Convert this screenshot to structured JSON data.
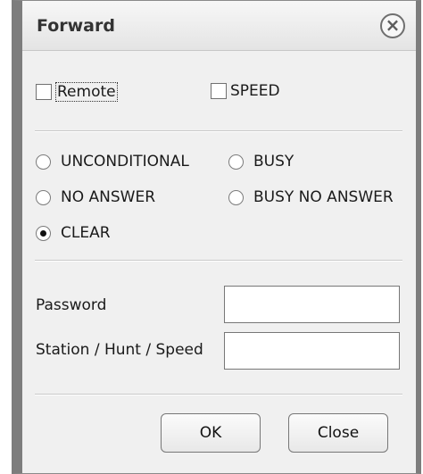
{
  "dialog": {
    "title": "Forward",
    "close_icon": "close-circle-x-icon"
  },
  "options": {
    "remote_label": "Remote",
    "speed_label": "SPEED"
  },
  "radios": {
    "unconditional": "UNCONDITIONAL",
    "busy": "BUSY",
    "no_answer": "NO ANSWER",
    "busy_no_answer": "BUSY NO ANSWER",
    "clear": "CLEAR",
    "selected": "CLEAR"
  },
  "fields": {
    "password_label": "Password",
    "station_label": "Station / Hunt / Speed",
    "password_value": "",
    "station_value": ""
  },
  "buttons": {
    "ok": "OK",
    "close": "Close"
  }
}
